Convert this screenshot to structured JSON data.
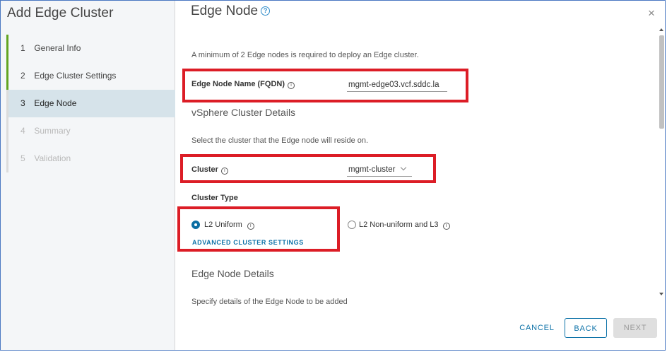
{
  "wizard": {
    "title": "Add Edge Cluster",
    "steps": [
      {
        "num": "1",
        "label": "General Info",
        "state": "done"
      },
      {
        "num": "2",
        "label": "Edge Cluster Settings",
        "state": "done"
      },
      {
        "num": "3",
        "label": "Edge Node",
        "state": "active"
      },
      {
        "num": "4",
        "label": "Summary",
        "state": "future"
      },
      {
        "num": "5",
        "label": "Validation",
        "state": "future"
      }
    ]
  },
  "page": {
    "title": "Edge Node",
    "help_icon": "?",
    "close_icon": "×",
    "intro": "A minimum of 2 Edge nodes is required to deploy an Edge cluster."
  },
  "edge_node_name": {
    "label": "Edge Node Name (FQDN)",
    "info_icon": "i",
    "value": "mgmt-edge03.vcf.sddc.la"
  },
  "vsphere": {
    "section_title": "vSphere Cluster Details",
    "desc": "Select the cluster that the Edge node will reside on.",
    "cluster_label": "Cluster",
    "cluster_info_icon": "i",
    "cluster_value": "mgmt-cluster"
  },
  "cluster_type": {
    "label": "Cluster Type",
    "options": [
      {
        "label": "L2 Uniform",
        "info_icon": "i",
        "checked": true
      },
      {
        "label": "L2 Non-uniform and L3",
        "info_icon": "i",
        "checked": false
      }
    ],
    "advanced_link": "ADVANCED CLUSTER SETTINGS"
  },
  "edge_node_details": {
    "section_title": "Edge Node Details",
    "desc": "Specify details of the Edge Node to be added"
  },
  "footer": {
    "cancel": "CANCEL",
    "back": "BACK",
    "next": "NEXT"
  },
  "colors": {
    "accent": "#0d72a8",
    "highlight": "#dc1d26",
    "step_done": "#62a420",
    "step_active_bg": "#d6e3ea"
  }
}
